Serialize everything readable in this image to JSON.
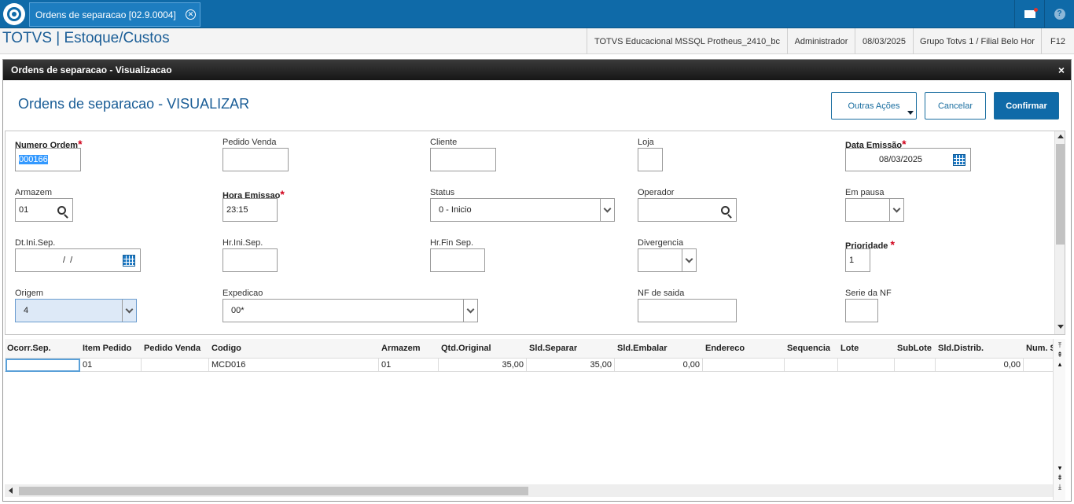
{
  "topbar": {
    "tab_label": "Ordens de separacao [02.9.0004]",
    "tab_close": "✕",
    "help_glyph": "?"
  },
  "header": {
    "app_title": "TOTVS | Estoque/Custos",
    "environment": "TOTVS Educacional MSSQL Protheus_2410_bc",
    "user": "Administrador",
    "date": "08/03/2025",
    "branch": "Grupo Totvs 1 / Filial Belo Hor",
    "shortcut": "F12"
  },
  "dialog": {
    "title": "Ordens de separacao - Visualizacao",
    "close": "×",
    "form_title": "Ordens de separacao - VISUALIZAR",
    "buttons": {
      "other_actions": "Outras Ações",
      "cancel": "Cancelar",
      "confirm": "Confirmar"
    }
  },
  "form": {
    "numero_ordem": {
      "label": "Numero Ordem",
      "value": "000166",
      "required": true
    },
    "pedido_venda": {
      "label": "Pedido Venda",
      "value": ""
    },
    "cliente": {
      "label": "Cliente",
      "value": ""
    },
    "loja": {
      "label": "Loja",
      "value": ""
    },
    "data_emissao": {
      "label": "Data Emissão",
      "value": "08/03/2025",
      "required": true
    },
    "armazem": {
      "label": "Armazem",
      "value": "01"
    },
    "hora_emissao": {
      "label": "Hora Emissao",
      "value": "23:15",
      "required": true
    },
    "status": {
      "label": "Status",
      "value": "0 - Inicio"
    },
    "operador": {
      "label": "Operador",
      "value": ""
    },
    "em_pausa": {
      "label": "Em pausa",
      "value": ""
    },
    "dt_ini_sep": {
      "label": "Dt.Ini.Sep.",
      "value": "/  /"
    },
    "hr_ini_sep": {
      "label": "Hr.Ini.Sep.",
      "value": ""
    },
    "hr_fin_sep": {
      "label": "Hr.Fin Sep.",
      "value": ""
    },
    "divergencia": {
      "label": "Divergencia",
      "value": ""
    },
    "prioridade": {
      "label": "Prioridade",
      "value": "1",
      "required": true
    },
    "origem": {
      "label": "Origem",
      "value": "4"
    },
    "expedicao": {
      "label": "Expedicao",
      "value": "00*"
    },
    "nf_saida": {
      "label": "NF de saida",
      "value": ""
    },
    "serie_nf": {
      "label": "Serie da NF",
      "value": ""
    },
    "required_mark": "*"
  },
  "grid": {
    "columns": [
      "Ocorr.Sep.",
      "Item Pedido",
      "Pedido Venda",
      "Codigo",
      "Armazem",
      "Qtd.Original",
      "Sld.Separar",
      "Sld.Embalar",
      "Endereco",
      "Sequencia",
      "Lote",
      "SubLote",
      "Sld.Distrib.",
      "Num. S"
    ],
    "rows": [
      [
        "",
        "01",
        "",
        "MCD016",
        "01",
        "35,00",
        "35,00",
        "0,00",
        "",
        "",
        "",
        "",
        "0,00",
        ""
      ]
    ]
  },
  "colors": {
    "topbar": "#0f6aa8",
    "accent": "#1a5d96",
    "required": "#d0021b"
  }
}
